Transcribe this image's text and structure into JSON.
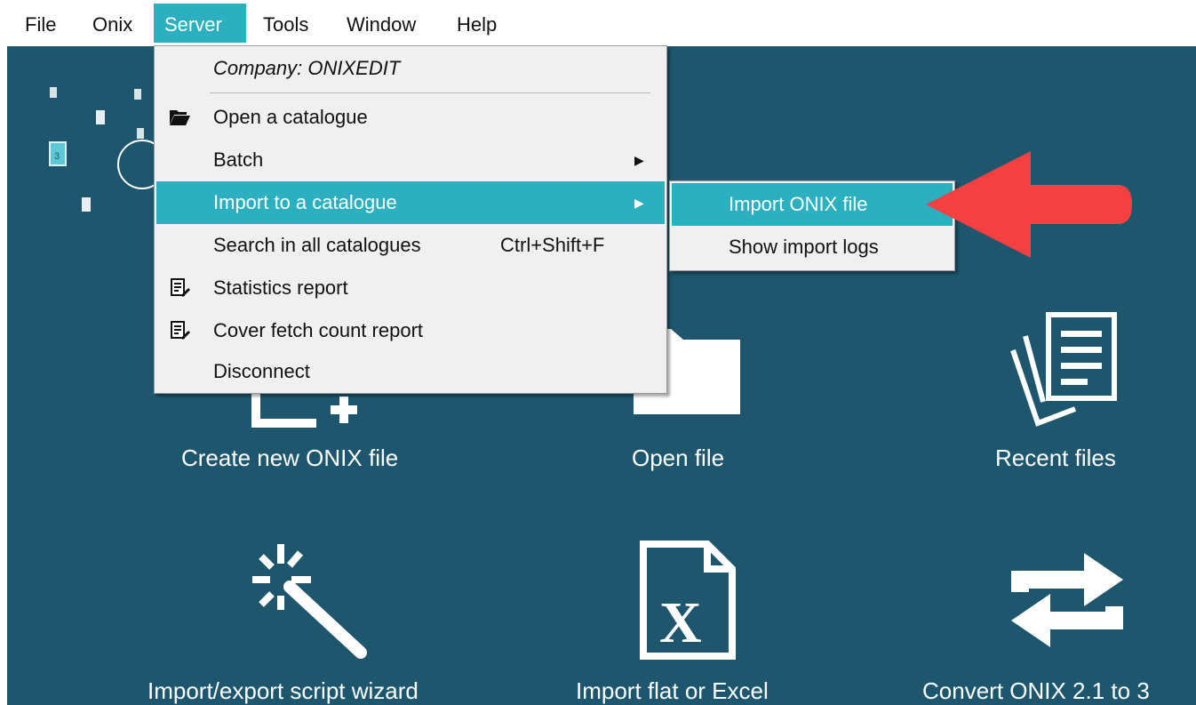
{
  "menubar": {
    "items": [
      {
        "label": "File"
      },
      {
        "label": "Onix"
      },
      {
        "label": "Server"
      },
      {
        "label": "Tools"
      },
      {
        "label": "Window"
      },
      {
        "label": "Help"
      }
    ],
    "active_color": "#2cb0bf"
  },
  "server_menu": {
    "header": "Company: ONIXEDIT",
    "items": [
      {
        "label": "Open a catalogue",
        "icon": "folder-open-icon"
      },
      {
        "label": "Batch",
        "has_submenu": true
      },
      {
        "label": "Import to a catalogue",
        "has_submenu": true,
        "highlighted": true
      },
      {
        "label": "Search in all catalogues",
        "shortcut": "Ctrl+Shift+F"
      },
      {
        "label": "Statistics report",
        "icon": "report-icon"
      },
      {
        "label": "Cover fetch count report",
        "icon": "report-icon"
      },
      {
        "label": "Disconnect"
      }
    ]
  },
  "import_submenu": {
    "items": [
      {
        "label": "Import ONIX file",
        "highlighted": true
      },
      {
        "label": "Show import logs"
      }
    ]
  },
  "desktop": {
    "background": "#1e576d",
    "tiles": [
      {
        "label": "Create new ONIX file",
        "icon": "new-file-icon"
      },
      {
        "label": "Open file",
        "icon": "folder-icon"
      },
      {
        "label": "Recent files",
        "icon": "recent-files-icon"
      },
      {
        "label": "Import/export script wizard",
        "icon": "magic-wand-icon"
      },
      {
        "label": "Import flat or Excel",
        "icon": "excel-file-icon"
      },
      {
        "label": "Convert ONIX 2.1 to 3",
        "icon": "convert-arrows-icon"
      }
    ]
  },
  "callout_arrow_color": "#f44040"
}
